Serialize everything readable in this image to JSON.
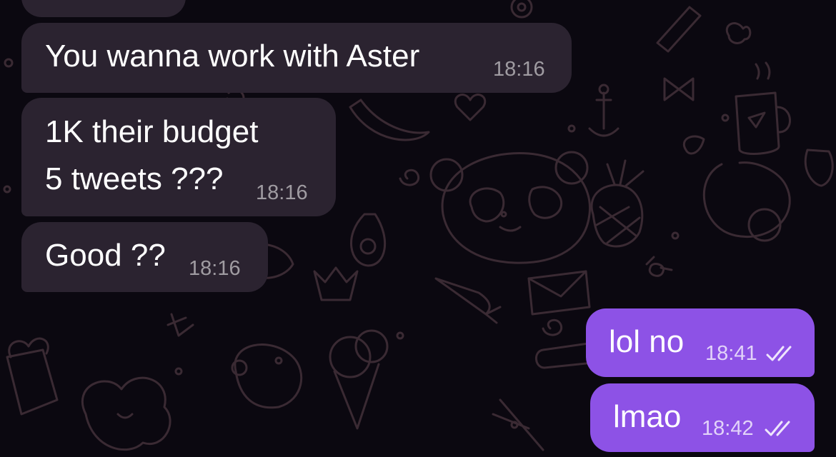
{
  "chat": {
    "incoming": [
      {
        "text": "You wanna work with Aster",
        "time": "18:16"
      },
      {
        "text": "1K their budget\n5 tweets ???",
        "time": "18:16"
      },
      {
        "text": "Good ??",
        "time": "18:16"
      }
    ],
    "outgoing": [
      {
        "text": "lol no",
        "time": "18:41",
        "status_icon": "double-check-icon"
      },
      {
        "text": "lmao",
        "time": "18:42",
        "status_icon": "double-check-icon"
      }
    ]
  },
  "colors": {
    "background": "#0b0810",
    "incoming_bubble": "#2b2330",
    "outgoing_bubble": "#8d52e6",
    "doodle_stroke": "#3a2a33"
  }
}
